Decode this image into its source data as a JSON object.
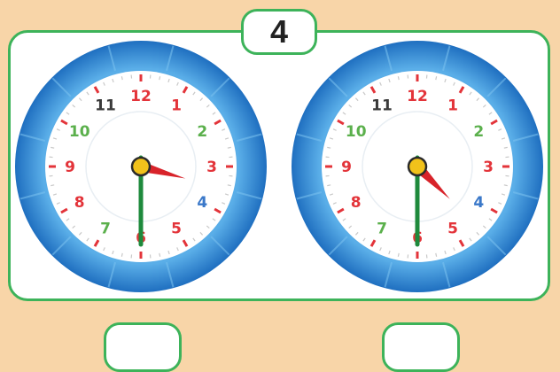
{
  "question_number": "4",
  "numerals": [
    "12",
    "1",
    "2",
    "3",
    "4",
    "5",
    "6",
    "7",
    "8",
    "9",
    "10",
    "11"
  ],
  "numeral_colors": [
    "#e3343a",
    "#e3343a",
    "#5bb04c",
    "#e3343a",
    "#3a78c9",
    "#e3343a",
    "#e3343a",
    "#5bb04c",
    "#e3343a",
    "#e3343a",
    "#5bb04c",
    "#3a3a3a"
  ],
  "clocks": [
    {
      "hour": 3,
      "minute": 30
    },
    {
      "hour": 4,
      "minute": 30
    }
  ],
  "answers": [
    "",
    ""
  ],
  "colors": {
    "background": "#f8d5a8",
    "border": "#3db35a",
    "bezel": "#2e86d4",
    "hour_hand": "#d8232a",
    "minute_hand": "#1e8a3c"
  }
}
